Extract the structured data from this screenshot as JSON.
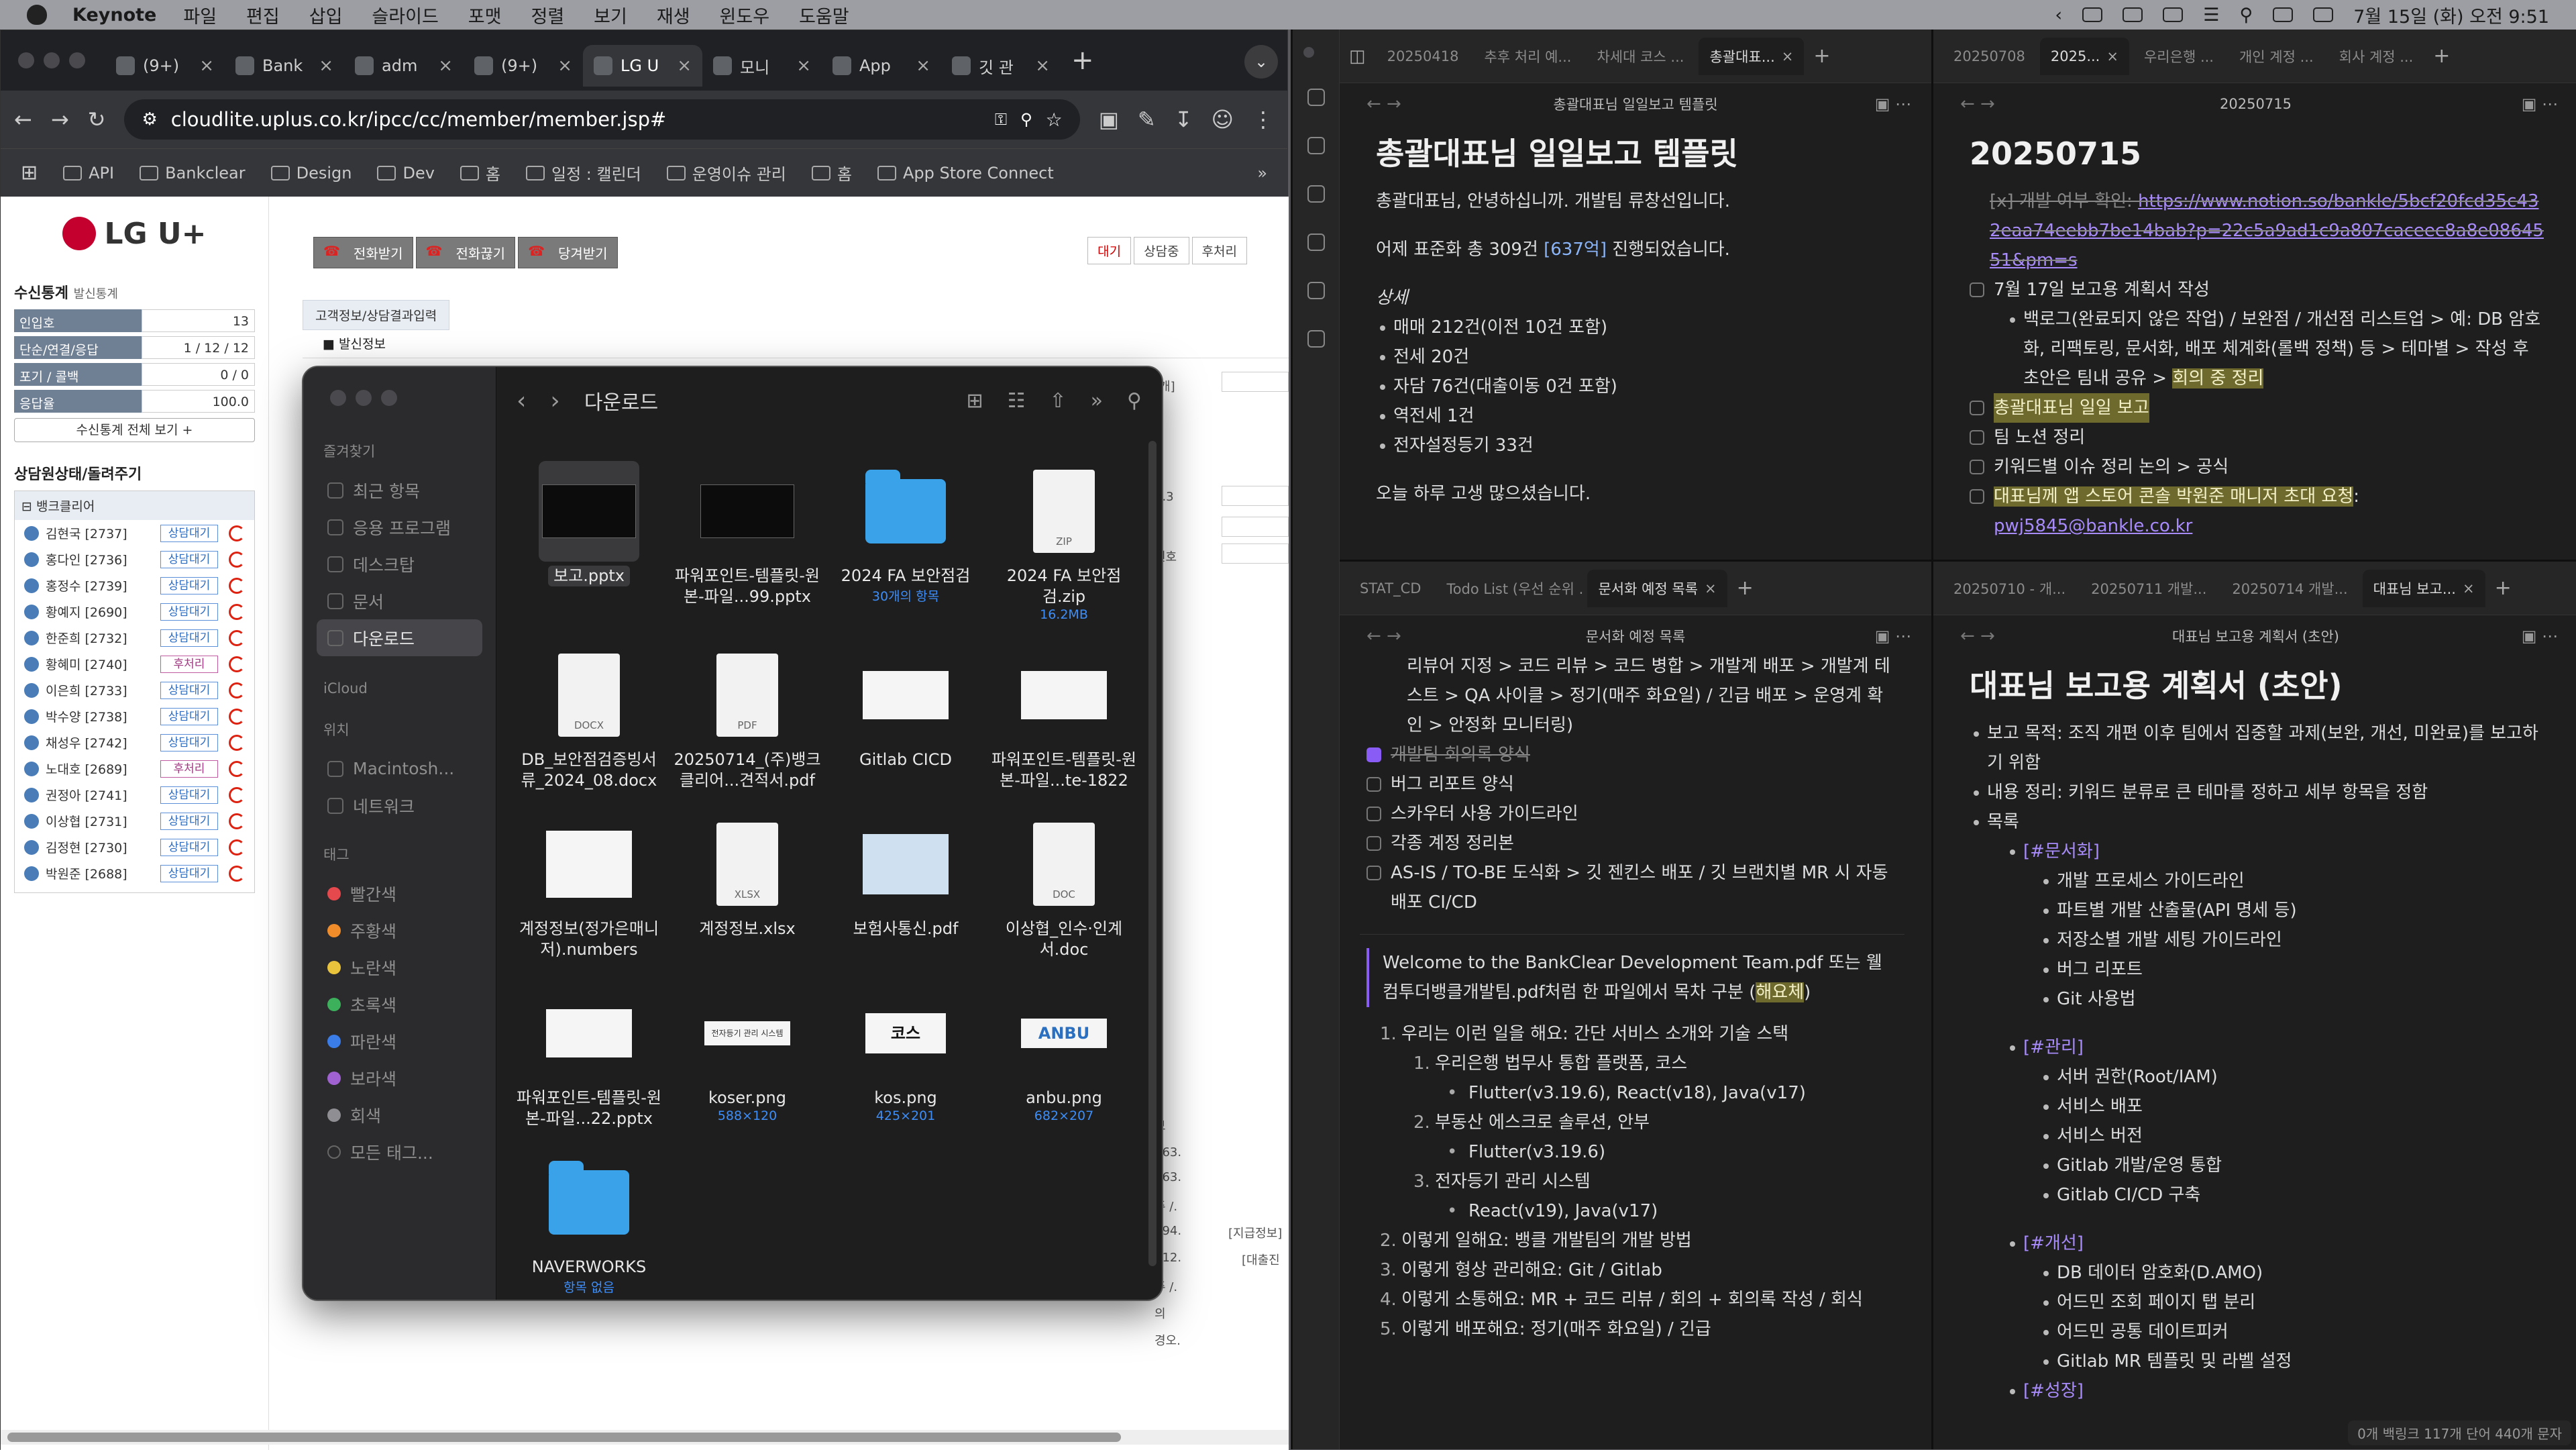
{
  "menubar": {
    "app": "Keynote",
    "items": [
      "파일",
      "편집",
      "삽입",
      "슬라이드",
      "포맷",
      "정렬",
      "보기",
      "재생",
      "윈도우",
      "도움말"
    ],
    "clock": "7월 15일 (화) 오전 9:51"
  },
  "browser": {
    "tabs": [
      {
        "label": "(9+)"
      },
      {
        "label": "Bank"
      },
      {
        "label": "adm"
      },
      {
        "label": "(9+)"
      },
      {
        "label": "LG U"
      },
      {
        "label": "모니"
      },
      {
        "label": "App"
      },
      {
        "label": "깃 관"
      }
    ],
    "url": "cloudlite.uplus.co.kr/ipcc/cc/member/member.jsp#",
    "bookmarks": [
      "API",
      "Bankclear",
      "Design",
      "Dev",
      "홈",
      "일정 : 캘린더",
      "운영이슈 관리",
      "홈",
      "App Store Connect"
    ]
  },
  "lg": {
    "logo": "LG U+",
    "stats_title": "수신통계",
    "stats_sub": "발신통계",
    "stats": [
      {
        "k": "인입호",
        "v": "13"
      },
      {
        "k": "단순/연결/응답",
        "v": "1 / 12 / 12"
      },
      {
        "k": "포기 / 콜백",
        "v": "0 / 0"
      },
      {
        "k": "응답율",
        "v": "100.0"
      }
    ],
    "stats_btn": "수신통계 전체 보기 +",
    "agent_title": "상담원상태/돌려주기",
    "group": "뱅크클리어",
    "agents": [
      {
        "name": "김현국 [2737]",
        "state": "상담대기"
      },
      {
        "name": "홍다인 [2736]",
        "state": "상담대기"
      },
      {
        "name": "홍정수 [2739]",
        "state": "상담대기"
      },
      {
        "name": "황예지 [2690]",
        "state": "상담대기"
      },
      {
        "name": "한준희 [2732]",
        "state": "상담대기"
      },
      {
        "name": "황혜미 [2740]",
        "state": "후처리"
      },
      {
        "name": "이은희 [2733]",
        "state": "상담대기"
      },
      {
        "name": "박수양 [2738]",
        "state": "상담대기"
      },
      {
        "name": "채성우 [2742]",
        "state": "상담대기"
      },
      {
        "name": "노대호 [2689]",
        "state": "후처리"
      },
      {
        "name": "권정아 [2741]",
        "state": "상담대기"
      },
      {
        "name": "이상협 [2731]",
        "state": "상담대기"
      },
      {
        "name": "김정현 [2730]",
        "state": "상담대기"
      },
      {
        "name": "박원준 [2688]",
        "state": "상담대기"
      }
    ],
    "call_buttons": [
      "전화받기",
      "전화끊기",
      "당겨받기"
    ],
    "state_tabs": [
      "대기",
      "상담중",
      "후처리"
    ],
    "content_tab": "고객정보/상담결과입력",
    "send_info": "발신정보",
    "peek": [
      "[개]",
      "3.3",
      "번호",
      "보",
      "163.",
      "163.",
      "주 /.",
      "594.",
      "712.",
      "주 /.",
      "의",
      "경오.",
      "[지급정보]",
      "[대출진"
    ]
  },
  "finder": {
    "folder_title": "다운로드",
    "sidebar": {
      "favorites_label": "즐겨찾기",
      "favorites": [
        "최근 항목",
        "응용 프로그램",
        "데스크탑",
        "문서",
        "다운로드"
      ],
      "icloud_label": "iCloud",
      "locations_label": "위치",
      "locations": [
        "Macintosh...",
        "네트워크"
      ],
      "tags_label": "태그",
      "tags": [
        {
          "name": "빨간색",
          "color": "#e5484d"
        },
        {
          "name": "주황색",
          "color": "#f08c2a"
        },
        {
          "name": "노란색",
          "color": "#e9c33b"
        },
        {
          "name": "초록색",
          "color": "#3db05c"
        },
        {
          "name": "파란색",
          "color": "#3a7ce8"
        },
        {
          "name": "보라색",
          "color": "#a061d1"
        },
        {
          "name": "회색",
          "color": "#8e8e93"
        },
        {
          "name": "모든 태그...",
          "color": ""
        }
      ]
    },
    "files": [
      {
        "name": "보고.pptx",
        "sub": "",
        "kind": "slide"
      },
      {
        "name": "파워포인트-템플릿-원본-파일...99.pptx",
        "sub": "",
        "kind": "slide"
      },
      {
        "name": "2024 FA 보안점검",
        "sub": "30개의 항목",
        "kind": "folder"
      },
      {
        "name": "2024 FA 보안점검.zip",
        "sub": "16.2MB",
        "kind": "zip"
      },
      {
        "name": "DB_보안점검증빙서류_2024_08.docx",
        "sub": "",
        "kind": "docx"
      },
      {
        "name": "20250714_(주)뱅크클리어...견적서.pdf",
        "sub": "",
        "kind": "pdf"
      },
      {
        "name": "Gitlab CICD",
        "sub": "",
        "kind": "wslide"
      },
      {
        "name": "파워포인트-템플릿-원본-파일...te-1822",
        "sub": "",
        "kind": "wslide"
      },
      {
        "name": "계정정보(정가은매니저).numbers",
        "sub": "",
        "kind": "numbers"
      },
      {
        "name": "계정정보.xlsx",
        "sub": "",
        "kind": "xlsx"
      },
      {
        "name": "보험사통신.pdf",
        "sub": "",
        "kind": "pdf2"
      },
      {
        "name": "이상협_인수·인계서.doc",
        "sub": "",
        "kind": "doc"
      },
      {
        "name": "파워포인트-템플릿-원본-파일...22.pptx",
        "sub": "",
        "kind": "wslide"
      },
      {
        "name": "koser.png",
        "sub": "588×120",
        "kind": "png"
      },
      {
        "name": "kos.png",
        "sub": "425×201",
        "kind": "kos"
      },
      {
        "name": "anbu.png",
        "sub": "682×207",
        "kind": "anbu"
      },
      {
        "name": "NAVERWORKS",
        "sub": "항목 없음",
        "kind": "folder"
      }
    ],
    "thumb_labels": {
      "zip": "ZIP",
      "docx": "DOCX",
      "pdf": "PDF",
      "xlsx": "XLSX",
      "doc": "DOC",
      "koser": "전자등기 관리 시스템",
      "kos": "코스",
      "anbu": "ANBU"
    }
  },
  "obsidian": {
    "tl": {
      "tabs": [
        "20250418",
        "추후 처리 예...",
        "차세대 코스 ...",
        "총괄대표..."
      ],
      "header": "총괄대표님 일일보고 템플릿",
      "title": "총괄대표님 일일보고 템플릿",
      "p1": "총괄대표님, 안녕하십니까. 개발팀 류창선입니다.",
      "p2_a": "어제 표준화 총 309건 ",
      "p2_b": "[637억]",
      "p2_c": " 진행되었습니다.",
      "detail": "상세",
      "items": [
        "매매 212건(이전 10건 포함)",
        "전세 20건",
        "자담 76건(대출이동 0건 포함)",
        "역전세 1건",
        "전자설정등기 33건"
      ],
      "closing": "오늘 하루 고생 많으셨습니다."
    },
    "tr": {
      "tabs": [
        "20250708",
        "2025...",
        "우리은행 ...",
        "개인 계정 ...",
        "회사 계정 ..."
      ],
      "header": "20250715",
      "title": "20250715",
      "done_a": "[x] 개발 여부 확인: ",
      "done_link": "https://www.notion.so/bankle/5bcf20fcd35c432eaa74eebb7be14bab?p=22c5a9ad1c9a807caceec8a8e0864551&pm=s",
      "task1": "7월 17일 보고용 계획서 작성",
      "task1_sub_a": "백로그(완료되지 않은 작업) / 보완점 / 개선점 리스트업 > 예: DB 암호화, 리팩토링, 문서화, 배포 체계화(롤백 정책) 등 > 테마별 > 작성 후 초안은 팀내 공유 > ",
      "task1_sub_hl": "회의 중 정리",
      "task2": "총괄대표님 일일 보고",
      "task3": "팀 노션 정리",
      "task4": "키워드별 이슈 정리 논의 > 공식",
      "task5_hl": "대표님께 앱 스토어 콘솔 박원준 매니저 초대 요청",
      "task5_sep": ": ",
      "task5_link": "pwj5845@bankle.co.kr"
    },
    "bl": {
      "tabs": [
        "STAT_CD",
        "Todo List (우선 순위 ...",
        "문서화 예정 목록"
      ],
      "header": "문서화 예정 목록",
      "top": "리뷰어 지정 > 코드 리뷰 > 코드 병합 > 개발계 배포 > 개발계 테스트 > QA 사이클 > 정기(매주 화요일) / 긴급 배포 > 운영계 확인 > 안정화 모니터링)",
      "checks": [
        {
          "t": "개발팀 회의록 양식",
          "done": true
        },
        {
          "t": "버그 리포트 양식",
          "done": false
        },
        {
          "t": "스카우터 사용 가이드라인",
          "done": false
        },
        {
          "t": "각종 계정 정리본",
          "done": false
        },
        {
          "t": "AS-IS / TO-BE 도식화 > 깃 젠킨스 배포 / 깃 브랜치별 MR 시 자동 배포 CI/CD",
          "done": false
        }
      ],
      "quote_a": "Welcome to the BankClear Development Team.pdf 또는 웰컴투더뱅클개발팀.pdf처럼 한 파일에서 목차 구분 (",
      "quote_hl": "해요체",
      "quote_b": ")",
      "ol": [
        {
          "n": "1.",
          "t": "우리는 이런 일을 해요: 간단 서비스 소개와 기술 스택",
          "lvl": 1
        },
        {
          "n": "1.",
          "t": "우리은행 법무사 통합 플랫폼, 코스",
          "lvl": 2
        },
        {
          "n": "",
          "t": "Flutter(v3.19.6), React(v18), Java(v17)",
          "lvl": 3
        },
        {
          "n": "2.",
          "t": "부동산 에스크로 솔루션, 안부",
          "lvl": 2
        },
        {
          "n": "",
          "t": "Flutter(v3.19.6)",
          "lvl": 3
        },
        {
          "n": "3.",
          "t": "전자등기 관리 시스템",
          "lvl": 2
        },
        {
          "n": "",
          "t": "React(v19), Java(v17)",
          "lvl": 3
        },
        {
          "n": "2.",
          "t": "이렇게 일해요: 뱅클 개발팀의 개발 방법",
          "lvl": 1
        },
        {
          "n": "3.",
          "t": "이렇게 형상 관리해요: Git / Gitlab",
          "lvl": 1
        },
        {
          "n": "4.",
          "t": "이렇게 소통해요: MR + 코드 리뷰 / 회의 + 회의록 작성 / 회식",
          "lvl": 1
        },
        {
          "n": "5.",
          "t": "이렇게 배포해요: 정기(매주 화요일) / 긴급",
          "lvl": 1
        }
      ]
    },
    "br": {
      "tabs": [
        "20250710 - 개...",
        "20250711 개발...",
        "20250714 개발...",
        "대표님 보고..."
      ],
      "header": "대표님 보고용 계획서 (초안)",
      "title": "대표님 보고용 계획서 (초안)",
      "p1": "보고 목적: 조직 개편 이후 팀에서 집중할 과제(보완, 개선, 미완료)를 보고하기 위함",
      "p2": "내용 정리: 키워드 분류로 큰 테마를 정하고 세부 항목을 정함",
      "p3": "목록",
      "sections": [
        {
          "tag": "[#문서화]",
          "items": [
            "개발 프로세스 가이드라인",
            "파트별 개발 산출물(API 명세 등)",
            "저장소별 개발 세팅 가이드라인",
            "버그 리포트",
            "Git 사용법"
          ]
        },
        {
          "tag": "[#관리]",
          "items": [
            "서버 권한(Root/IAM)",
            "서비스 배포",
            "서비스 버전",
            "Gitlab 개발/운영 통합",
            "Gitlab CI/CD 구축"
          ]
        },
        {
          "tag": "[#개선]",
          "items": [
            "DB 데이터 암호화(D.AMO)",
            "어드민 조회 페이지 탭 분리",
            "어드민 공통 데이트피커",
            "Gitlab MR 템플릿 및 라벨 설정"
          ]
        }
      ],
      "more": "[#성장]"
    },
    "status": "0개 백링크   117개 단어   440개 문자"
  }
}
